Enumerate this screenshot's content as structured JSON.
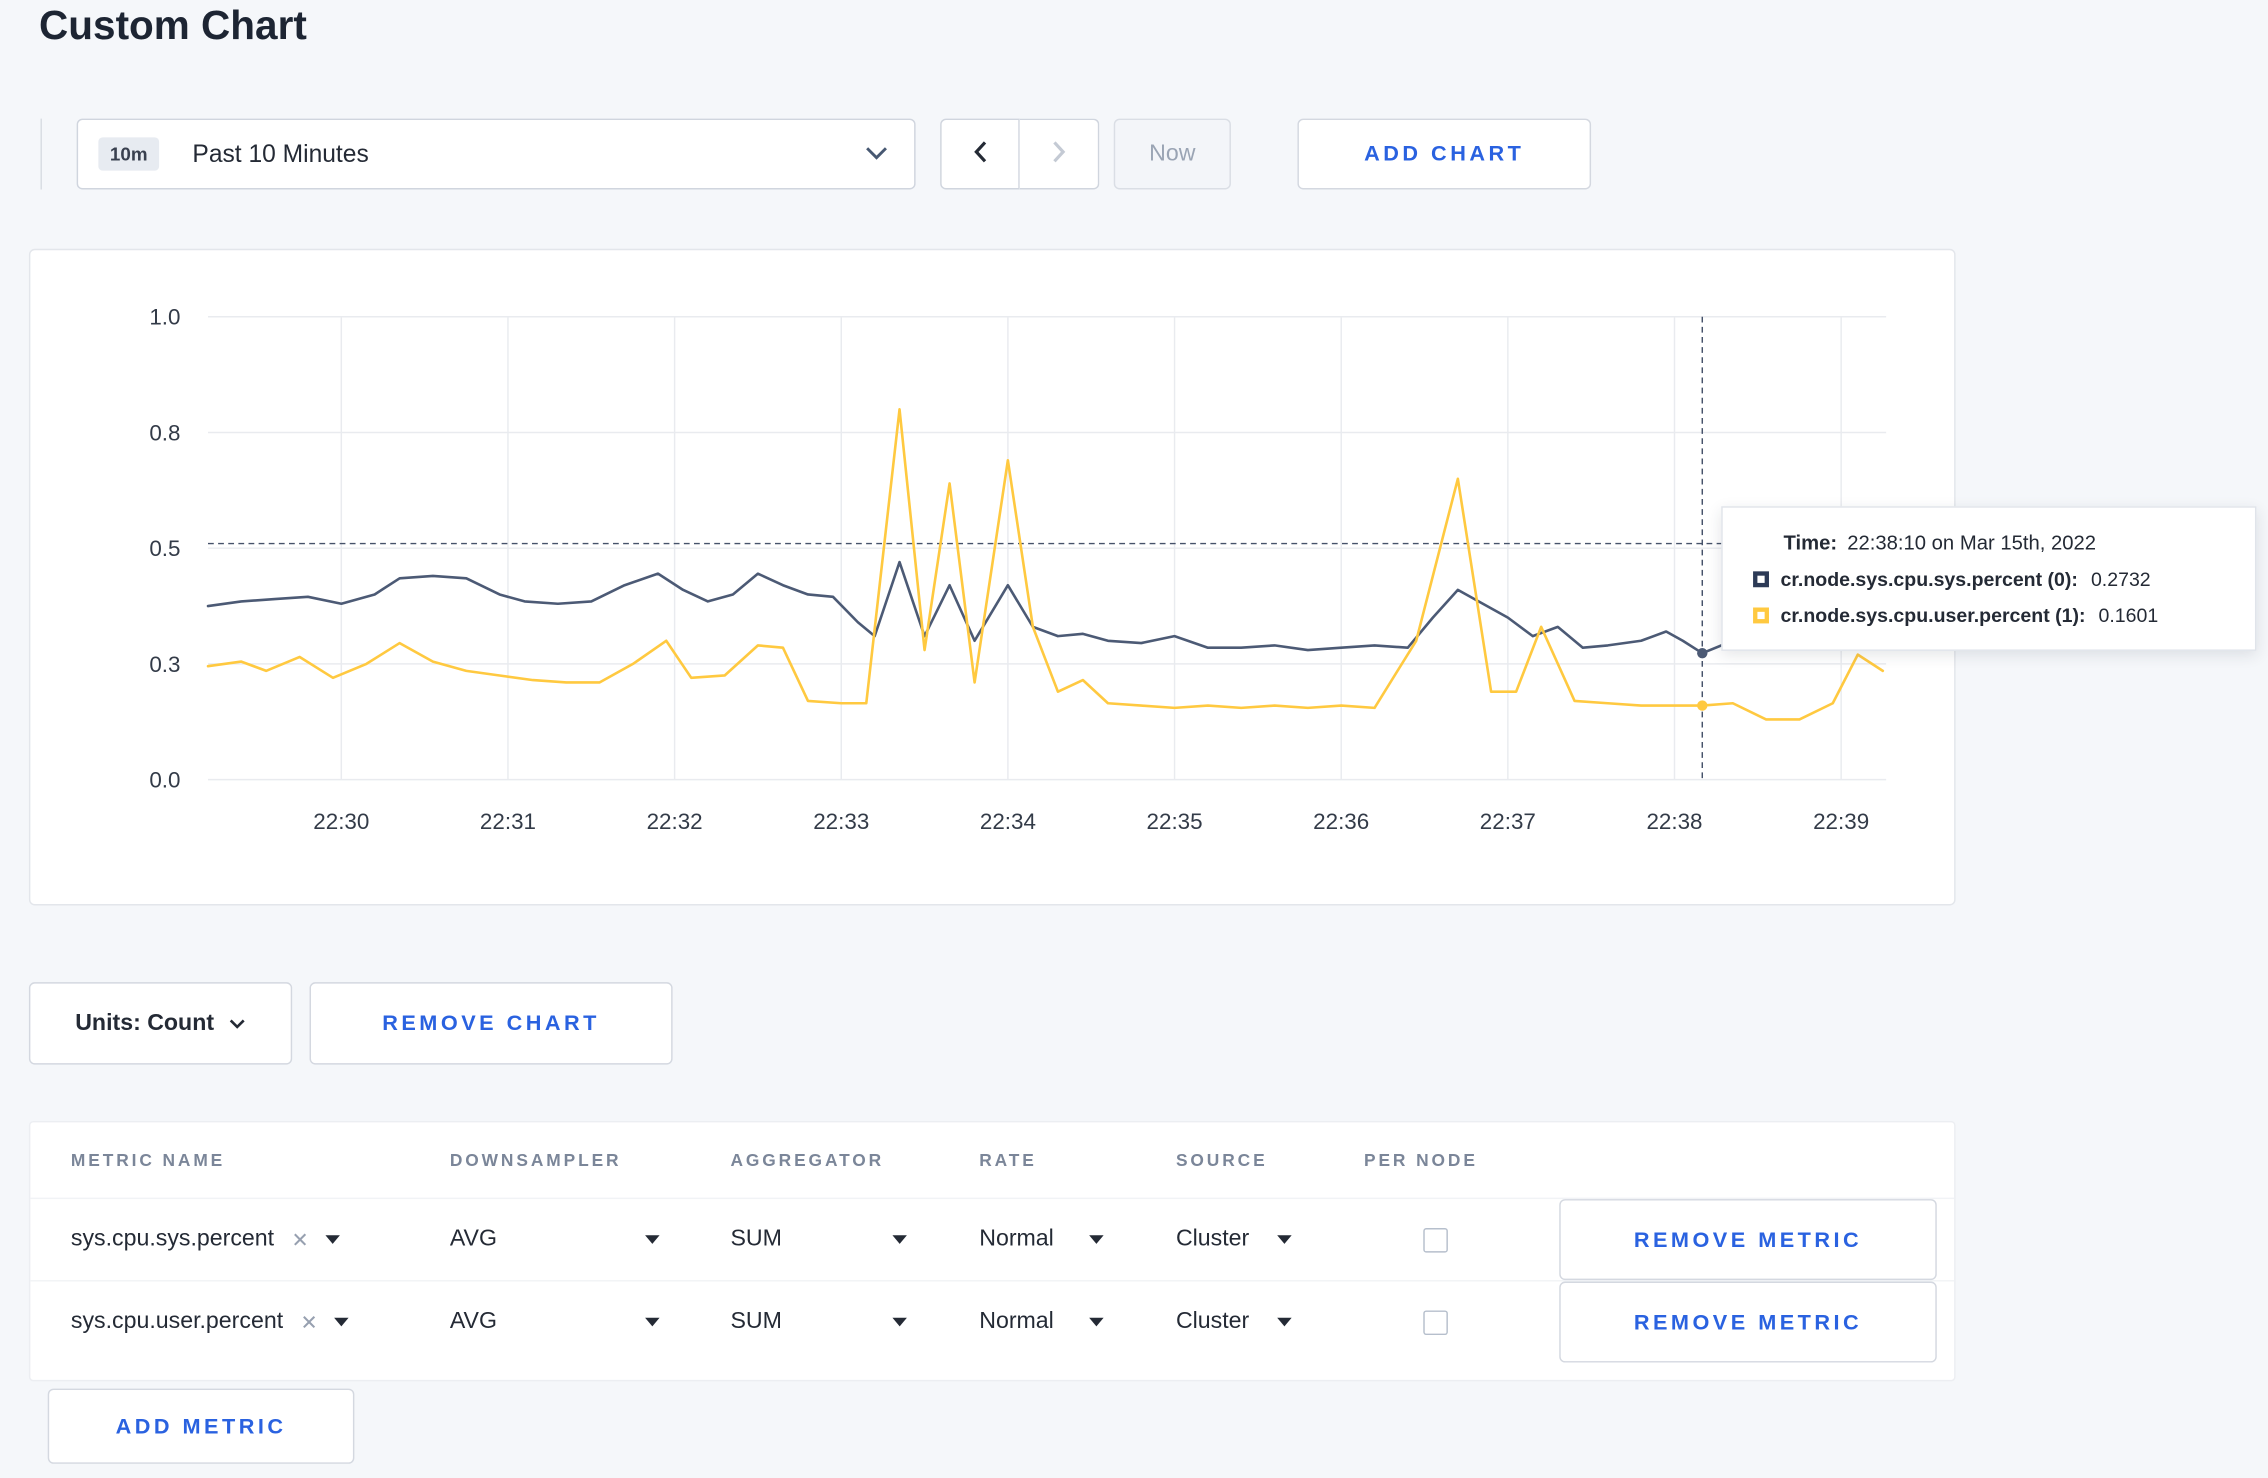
{
  "page": {
    "title": "Custom Chart"
  },
  "colors": {
    "accent_blue": "#2a62e0",
    "series_sys": "#4c5a75",
    "series_user": "#ffc940",
    "page_bg": "#f5f7fa"
  },
  "toolbar": {
    "range_badge": "10m",
    "range_label": "Past 10 Minutes",
    "now_label": "Now",
    "add_chart_label": "ADD CHART"
  },
  "chart_controls": {
    "units_label": "Units: Count",
    "remove_chart_label": "REMOVE CHART",
    "add_metric_label": "ADD METRIC"
  },
  "tooltip": {
    "time_label": "Time:",
    "time_value": "22:38:10 on Mar 15th, 2022",
    "series": [
      {
        "name": "cr.node.sys.cpu.sys.percent (0):",
        "value": "0.2732",
        "color": "#2c3a56"
      },
      {
        "name": "cr.node.sys.cpu.user.percent (1):",
        "value": "0.1601",
        "color": "#ffc940"
      }
    ]
  },
  "metrics_table": {
    "headers": [
      "METRIC NAME",
      "DOWNSAMPLER",
      "AGGREGATOR",
      "RATE",
      "SOURCE",
      "PER NODE"
    ],
    "rows": [
      {
        "metric": "sys.cpu.sys.percent",
        "downsampler": "AVG",
        "aggregator": "SUM",
        "rate": "Normal",
        "source": "Cluster",
        "per_node": false,
        "remove_label": "REMOVE METRIC"
      },
      {
        "metric": "sys.cpu.user.percent",
        "downsampler": "AVG",
        "aggregator": "SUM",
        "rate": "Normal",
        "source": "Cluster",
        "per_node": false,
        "remove_label": "REMOVE METRIC"
      }
    ]
  },
  "chart_data": {
    "type": "line",
    "title": "",
    "xlabel": "",
    "ylabel": "",
    "x_unit": "minutes within hour 22:00",
    "x_range": [
      29.2,
      39.27
    ],
    "y_range": [
      0,
      1
    ],
    "grid": true,
    "legend_position": "tooltip",
    "x_ticks": [
      {
        "t": 30,
        "label": "22:30"
      },
      {
        "t": 31,
        "label": "22:31"
      },
      {
        "t": 32,
        "label": "22:32"
      },
      {
        "t": 33,
        "label": "22:33"
      },
      {
        "t": 34,
        "label": "22:34"
      },
      {
        "t": 35,
        "label": "22:35"
      },
      {
        "t": 36,
        "label": "22:36"
      },
      {
        "t": 37,
        "label": "22:37"
      },
      {
        "t": 38,
        "label": "22:38"
      },
      {
        "t": 39,
        "label": "22:39"
      }
    ],
    "y_ticks": [
      {
        "v": 0,
        "label": "0.0"
      },
      {
        "v": 0.25,
        "label": "0.3"
      },
      {
        "v": 0.5,
        "label": "0.5"
      },
      {
        "v": 0.75,
        "label": "0.8"
      },
      {
        "v": 1,
        "label": "1.0"
      }
    ],
    "crosshair": {
      "t": 38.1667,
      "hline_v": 0.51
    },
    "hover_points": [
      {
        "t": 38.1667,
        "v": 0.2732,
        "color": "#4c5a75"
      },
      {
        "t": 38.1667,
        "v": 0.1601,
        "color": "#ffc940"
      }
    ],
    "series": [
      {
        "name": "cr.node.sys.cpu.sys.percent",
        "color": "#4c5a75",
        "points": [
          [
            29.2,
            0.375
          ],
          [
            29.4,
            0.385
          ],
          [
            29.6,
            0.39
          ],
          [
            29.8,
            0.395
          ],
          [
            30.0,
            0.38
          ],
          [
            30.2,
            0.4
          ],
          [
            30.35,
            0.435
          ],
          [
            30.55,
            0.44
          ],
          [
            30.75,
            0.435
          ],
          [
            30.95,
            0.4
          ],
          [
            31.1,
            0.385
          ],
          [
            31.3,
            0.38
          ],
          [
            31.5,
            0.385
          ],
          [
            31.7,
            0.42
          ],
          [
            31.9,
            0.445
          ],
          [
            32.05,
            0.41
          ],
          [
            32.2,
            0.385
          ],
          [
            32.35,
            0.4
          ],
          [
            32.5,
            0.445
          ],
          [
            32.65,
            0.42
          ],
          [
            32.8,
            0.4
          ],
          [
            32.95,
            0.395
          ],
          [
            33.1,
            0.34
          ],
          [
            33.2,
            0.31
          ],
          [
            33.35,
            0.47
          ],
          [
            33.5,
            0.31
          ],
          [
            33.65,
            0.42
          ],
          [
            33.8,
            0.3
          ],
          [
            34.0,
            0.42
          ],
          [
            34.15,
            0.33
          ],
          [
            34.3,
            0.31
          ],
          [
            34.45,
            0.315
          ],
          [
            34.6,
            0.3
          ],
          [
            34.8,
            0.295
          ],
          [
            35.0,
            0.31
          ],
          [
            35.2,
            0.285
          ],
          [
            35.4,
            0.285
          ],
          [
            35.6,
            0.29
          ],
          [
            35.8,
            0.28
          ],
          [
            36.0,
            0.285
          ],
          [
            36.2,
            0.29
          ],
          [
            36.4,
            0.285
          ],
          [
            36.55,
            0.35
          ],
          [
            36.7,
            0.41
          ],
          [
            36.85,
            0.38
          ],
          [
            37.0,
            0.35
          ],
          [
            37.15,
            0.31
          ],
          [
            37.3,
            0.33
          ],
          [
            37.45,
            0.285
          ],
          [
            37.6,
            0.29
          ],
          [
            37.8,
            0.3
          ],
          [
            37.95,
            0.32
          ],
          [
            38.05,
            0.3
          ],
          [
            38.1667,
            0.2732
          ],
          [
            38.35,
            0.3
          ],
          [
            38.5,
            0.31
          ],
          [
            38.7,
            0.3
          ],
          [
            38.9,
            0.305
          ],
          [
            39.1,
            0.3
          ],
          [
            39.25,
            0.3
          ]
        ]
      },
      {
        "name": "cr.node.sys.cpu.user.percent",
        "color": "#ffc940",
        "points": [
          [
            29.2,
            0.245
          ],
          [
            29.4,
            0.255
          ],
          [
            29.55,
            0.235
          ],
          [
            29.75,
            0.265
          ],
          [
            29.95,
            0.22
          ],
          [
            30.15,
            0.25
          ],
          [
            30.35,
            0.295
          ],
          [
            30.55,
            0.255
          ],
          [
            30.75,
            0.235
          ],
          [
            30.95,
            0.225
          ],
          [
            31.15,
            0.215
          ],
          [
            31.35,
            0.21
          ],
          [
            31.55,
            0.21
          ],
          [
            31.75,
            0.25
          ],
          [
            31.95,
            0.3
          ],
          [
            32.1,
            0.22
          ],
          [
            32.3,
            0.225
          ],
          [
            32.5,
            0.29
          ],
          [
            32.65,
            0.285
          ],
          [
            32.8,
            0.17
          ],
          [
            33.0,
            0.165
          ],
          [
            33.15,
            0.165
          ],
          [
            33.35,
            0.8
          ],
          [
            33.5,
            0.28
          ],
          [
            33.65,
            0.64
          ],
          [
            33.8,
            0.21
          ],
          [
            34.0,
            0.69
          ],
          [
            34.15,
            0.33
          ],
          [
            34.3,
            0.19
          ],
          [
            34.45,
            0.215
          ],
          [
            34.6,
            0.165
          ],
          [
            34.8,
            0.16
          ],
          [
            35.0,
            0.155
          ],
          [
            35.2,
            0.16
          ],
          [
            35.4,
            0.155
          ],
          [
            35.6,
            0.16
          ],
          [
            35.8,
            0.155
          ],
          [
            36.0,
            0.16
          ],
          [
            36.2,
            0.155
          ],
          [
            36.45,
            0.3
          ],
          [
            36.7,
            0.65
          ],
          [
            36.9,
            0.19
          ],
          [
            37.05,
            0.19
          ],
          [
            37.2,
            0.33
          ],
          [
            37.4,
            0.17
          ],
          [
            37.6,
            0.165
          ],
          [
            37.8,
            0.16
          ],
          [
            38.0,
            0.16
          ],
          [
            38.1667,
            0.1601
          ],
          [
            38.35,
            0.165
          ],
          [
            38.55,
            0.13
          ],
          [
            38.75,
            0.13
          ],
          [
            38.95,
            0.165
          ],
          [
            39.1,
            0.27
          ],
          [
            39.25,
            0.235
          ]
        ]
      }
    ]
  }
}
